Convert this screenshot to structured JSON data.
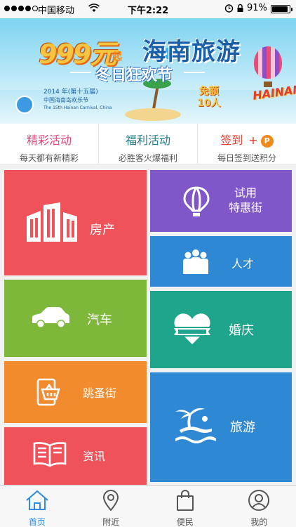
{
  "status_bar": {
    "carrier": "中国移动",
    "time": "下午2:22",
    "battery": "91%",
    "battery_level": 0.91,
    "signal_bars": 4,
    "signal_total": 5
  },
  "banner": {
    "price": "999元",
    "price_suffix": "起",
    "title": "海南旅游",
    "subtitle": "冬日狂欢节",
    "event_line1": "2014 年(第十五届)",
    "event_line2": "中国海南岛欢乐节",
    "event_line3": "The 15th Hainan Carnival, China",
    "free_line1": "免额",
    "free_line2": "10人",
    "logo_text": "HAINAN",
    "page_count": 5,
    "active_page": 1
  },
  "activities": [
    {
      "title": "精彩活动",
      "desc": "每天都有新精彩",
      "color": "#e0467a"
    },
    {
      "title": "福利活动",
      "desc": "必胜客火爆福利",
      "color": "#1d7a86"
    },
    {
      "title": "签到",
      "plus": "+",
      "badge": "P",
      "desc": "每日签到送积分",
      "color": "#e33a2b"
    }
  ],
  "tiles": {
    "real_estate": {
      "label": "房产",
      "color": "#f0525a",
      "icon": "buildings-icon"
    },
    "trial": {
      "label_line1": "试用",
      "label_line2": "特惠街",
      "color": "#8057c8",
      "icon": "balloon-icon"
    },
    "talent": {
      "label": "人才",
      "color": "#2e88d4",
      "icon": "people-icon"
    },
    "car": {
      "label": "汽车",
      "color": "#7db83a",
      "icon": "car-icon"
    },
    "wedding": {
      "label": "婚庆",
      "color": "#1fa58c",
      "icon": "heart-icon"
    },
    "flea_market": {
      "label": "跳蚤街",
      "color": "#f28a2e",
      "icon": "shopping-basket-icon"
    },
    "travel": {
      "label": "旅游",
      "color": "#2e88d4",
      "icon": "island-icon"
    },
    "news": {
      "label": "资讯",
      "color": "#f0525a",
      "icon": "book-icon"
    }
  },
  "tab_bar": [
    {
      "label": "首页",
      "icon": "home-icon",
      "active": true
    },
    {
      "label": "附近",
      "icon": "location-pin-icon",
      "active": false
    },
    {
      "label": "便民",
      "icon": "shopping-bag-icon",
      "active": false
    },
    {
      "label": "我的",
      "icon": "user-icon",
      "active": false
    }
  ]
}
